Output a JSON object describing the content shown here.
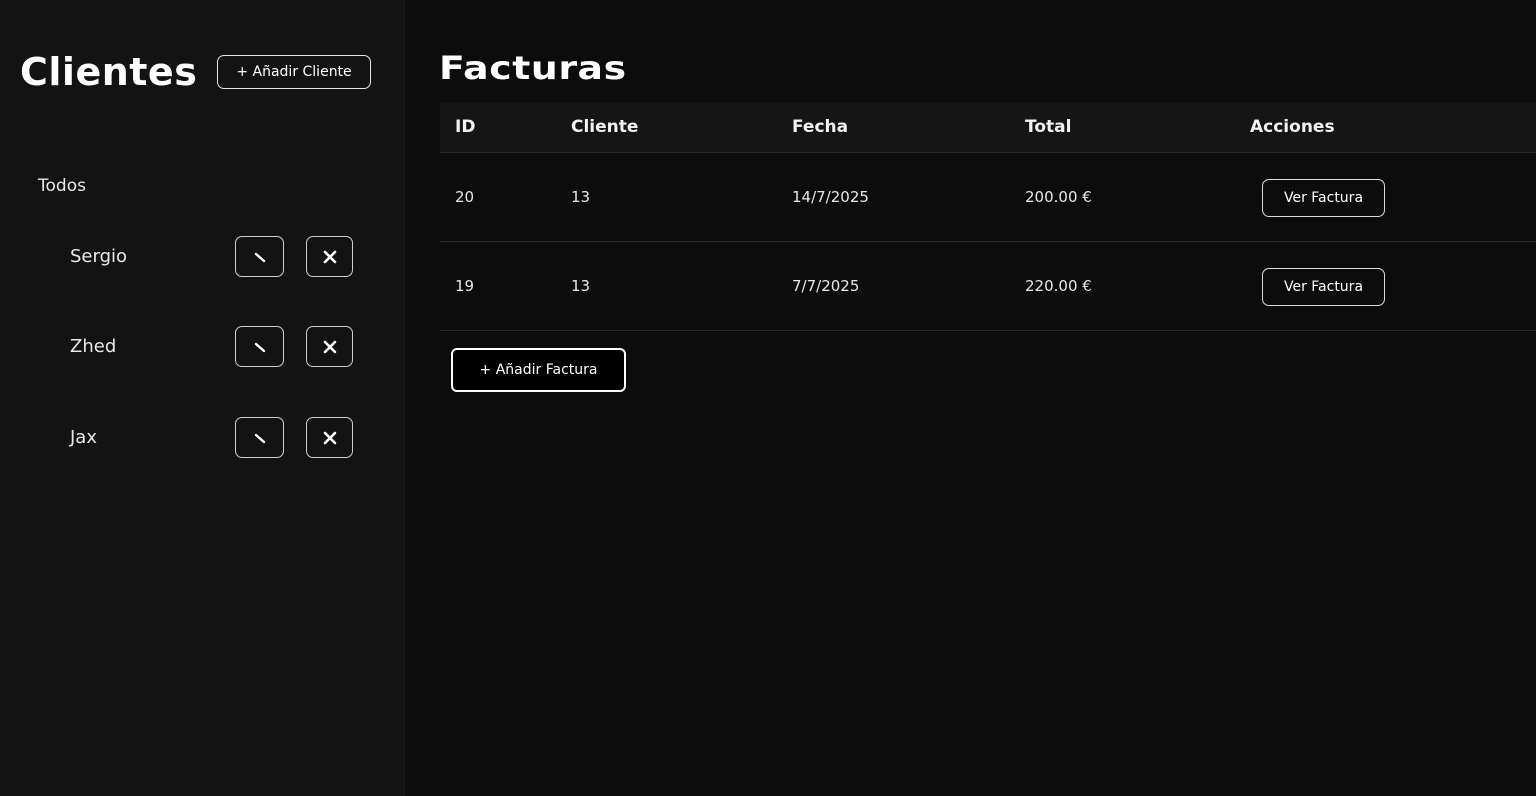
{
  "sidebar": {
    "title": "Clientes",
    "add_button": "+ Añadir Cliente",
    "filter_all": "Todos",
    "clients": [
      {
        "name": "Sergio",
        "edit_icon": "pencil-icon",
        "delete_icon": "close-icon"
      },
      {
        "name": "Zhed",
        "edit_icon": "pencil-icon",
        "delete_icon": "close-icon"
      },
      {
        "name": "Jax",
        "edit_icon": "pencil-icon",
        "delete_icon": "close-icon"
      }
    ]
  },
  "main": {
    "title": "Facturas",
    "table": {
      "headers": {
        "id": "ID",
        "client": "Cliente",
        "date": "Fecha",
        "total": "Total",
        "actions": "Acciones"
      },
      "rows": [
        {
          "id": "20",
          "client": "13",
          "date": "14/7/2025",
          "total": "200.00 €",
          "action": "Ver Factura"
        },
        {
          "id": "19",
          "client": "13",
          "date": "7/7/2025",
          "total": "220.00 €",
          "action": "Ver Factura"
        }
      ]
    },
    "add_button": "+ Añadir Factura"
  },
  "colors": {
    "background": "#0c0c0c",
    "sidebar": "#131313",
    "header_row": "#151515",
    "text": "#f2f2f2",
    "border": "#2a2a2a"
  }
}
